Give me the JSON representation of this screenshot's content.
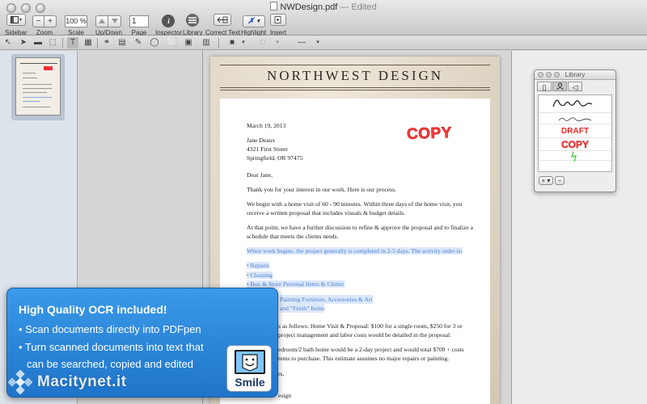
{
  "window": {
    "title": "NWDesign.pdf",
    "title_suffix": "— Edited"
  },
  "toolbar": {
    "sidebar_label": "Sidebar",
    "zoom_label": "Zoom",
    "zoom_out": "−",
    "zoom_in": "+",
    "scale_value": "100 %",
    "scale_label": "Scale",
    "updown_label": "Up/Down",
    "page_value": "1",
    "page_label": "Page",
    "inspector_label": "Inspector",
    "library_label": "Library",
    "correct_text_label": "Correct Text",
    "highlight_label": "Highlight",
    "insert_label": "Insert"
  },
  "document": {
    "letterhead": "NORTHWEST DESIGN",
    "stamp": "COPY",
    "date": "March 19, 2013",
    "address": [
      "Jane Deaux",
      "4321 First Street",
      "Springfield, OR  97475"
    ],
    "salutation": "Dear Jane,",
    "paragraphs": [
      "Thank you for your interest in our work. Here is our process.",
      "We begin with a home visit of 60 - 90 minutes. Within three days of the home visit, you receive a written proposal that includes visuals & budget details.",
      "At that point, we have a further discussion to refine & approve the proposal and to finalize a schedule that meets the clients needs."
    ],
    "highlighted_intro": "When work begins, the project generally is completed in 2-5 days. The activity order is:",
    "highlighted_items": [
      "• Repairs",
      "• Cleaning",
      "• Box & Store Personal Items & Clutter"
    ],
    "partial_lines": [
      "Painting Furniture, Accessories & Art",
      "and “Fresh” Items",
      "s as follows: Home Visit & Proposal: $100 for a single room, $250 for 3 or",
      "project management and labor costs would be detailed in the proposal.",
      "edroom/2 bath home would be a 2-day project and would total $700 + costs",
      "tems to purchase. This estimate assumes no major repairs or painting.",
      "rs,",
      "esign"
    ]
  },
  "library": {
    "title": "Library",
    "draft": "DRAFT",
    "copy": "COPY",
    "add": "+ ▾",
    "remove": "−"
  },
  "promo": {
    "headline": "High Quality OCR included!",
    "bullet1": "• Scan documents directly into PDFpen",
    "bullet2": "• Turn scanned documents into text that",
    "bullet2_cont": "can be searched, copied and edited",
    "logo_text": "Smile",
    "watermark": "Macitynet.it"
  }
}
